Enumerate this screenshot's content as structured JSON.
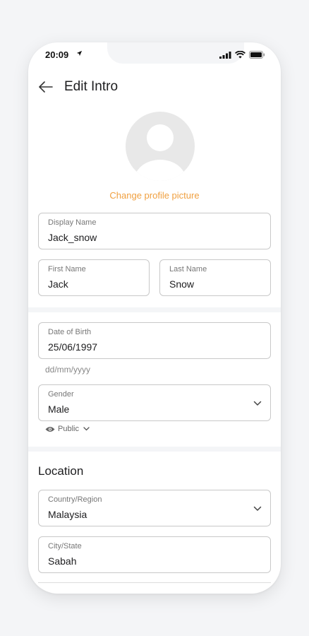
{
  "status": {
    "time": "20:09"
  },
  "header": {
    "title": "Edit Intro"
  },
  "profile": {
    "change_picture": "Change profile picture"
  },
  "fields": {
    "display_name": {
      "label": "Display Name",
      "value": "Jack_snow"
    },
    "first_name": {
      "label": "First Name",
      "value": "Jack"
    },
    "last_name": {
      "label": "Last Name",
      "value": "Snow"
    },
    "dob": {
      "label": "Date of Birth",
      "value": "25/06/1997",
      "hint": "dd/mm/yyyy"
    },
    "gender": {
      "label": "Gender",
      "value": "Male"
    }
  },
  "visibility": {
    "label": "Public"
  },
  "location": {
    "title": "Location",
    "country": {
      "label": "Country/Region",
      "value": "Malaysia"
    },
    "city": {
      "label": "City/State",
      "value": "Sabah"
    }
  },
  "colors": {
    "accent": "#f0a040",
    "border": "#c8c8c8",
    "text": "#1d1d1f"
  }
}
